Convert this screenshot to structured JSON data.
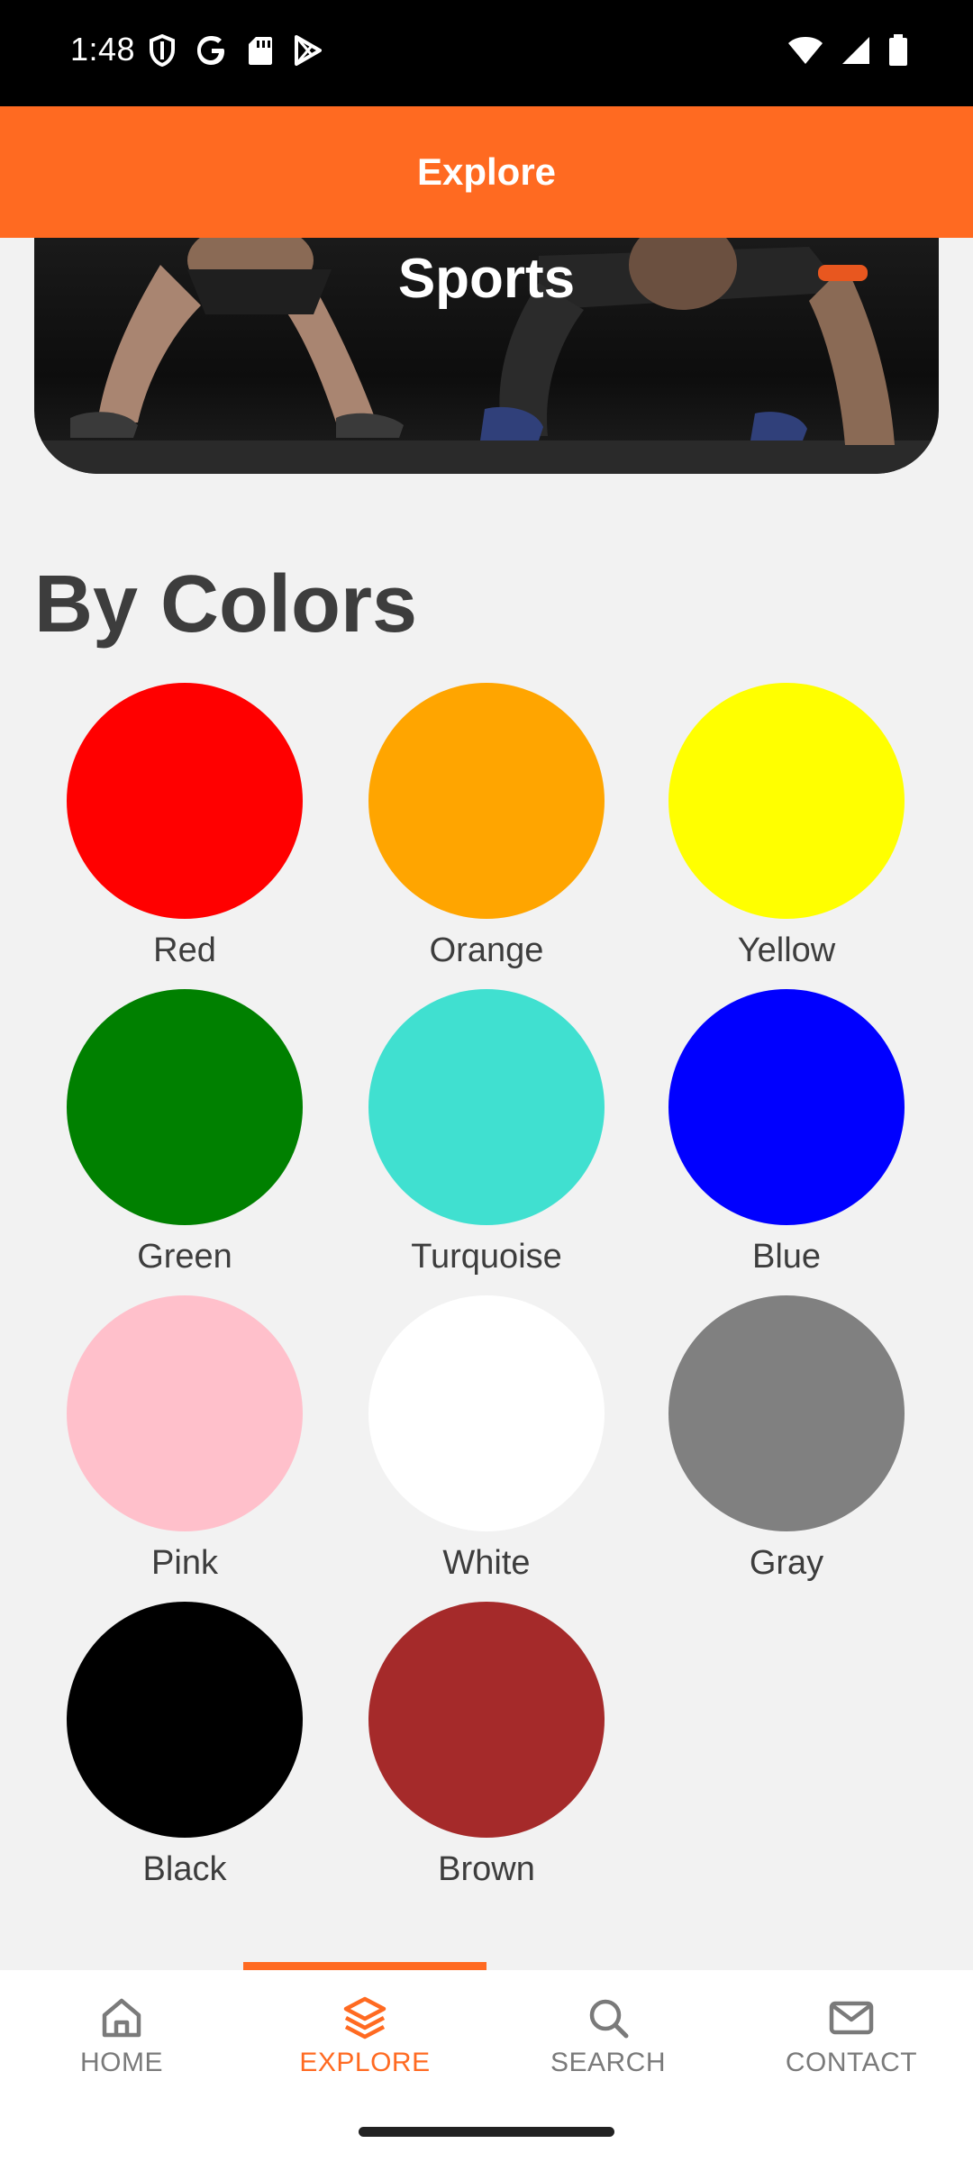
{
  "status_bar": {
    "time": "1:48",
    "left_icons": [
      "shield-icon",
      "google-icon",
      "sd-card-icon",
      "play-store-icon"
    ],
    "right_icons": [
      "wifi-icon",
      "signal-icon",
      "battery-icon"
    ]
  },
  "app_bar": {
    "title": "Explore"
  },
  "banner": {
    "label": "Sports"
  },
  "section": {
    "title": "By Colors"
  },
  "colors": [
    {
      "label": "Red",
      "hex": "#ff0000"
    },
    {
      "label": "Orange",
      "hex": "#ffa500"
    },
    {
      "label": "Yellow",
      "hex": "#ffff00"
    },
    {
      "label": "Green",
      "hex": "#008000"
    },
    {
      "label": "Turquoise",
      "hex": "#40e0d0"
    },
    {
      "label": "Blue",
      "hex": "#0000ff"
    },
    {
      "label": "Pink",
      "hex": "#ffc0cb"
    },
    {
      "label": "White",
      "hex": "#ffffff"
    },
    {
      "label": "Gray",
      "hex": "#808080"
    },
    {
      "label": "Black",
      "hex": "#000000"
    },
    {
      "label": "Brown",
      "hex": "#a52a2a"
    }
  ],
  "bottom_nav": {
    "items": [
      {
        "label": "HOME",
        "icon": "home-icon",
        "active": false
      },
      {
        "label": "EXPLORE",
        "icon": "layers-icon",
        "active": true
      },
      {
        "label": "SEARCH",
        "icon": "search-icon",
        "active": false
      },
      {
        "label": "CONTACT",
        "icon": "mail-icon",
        "active": false
      }
    ]
  },
  "theme": {
    "accent": "#ff6a21",
    "background": "#f2f2f2"
  }
}
